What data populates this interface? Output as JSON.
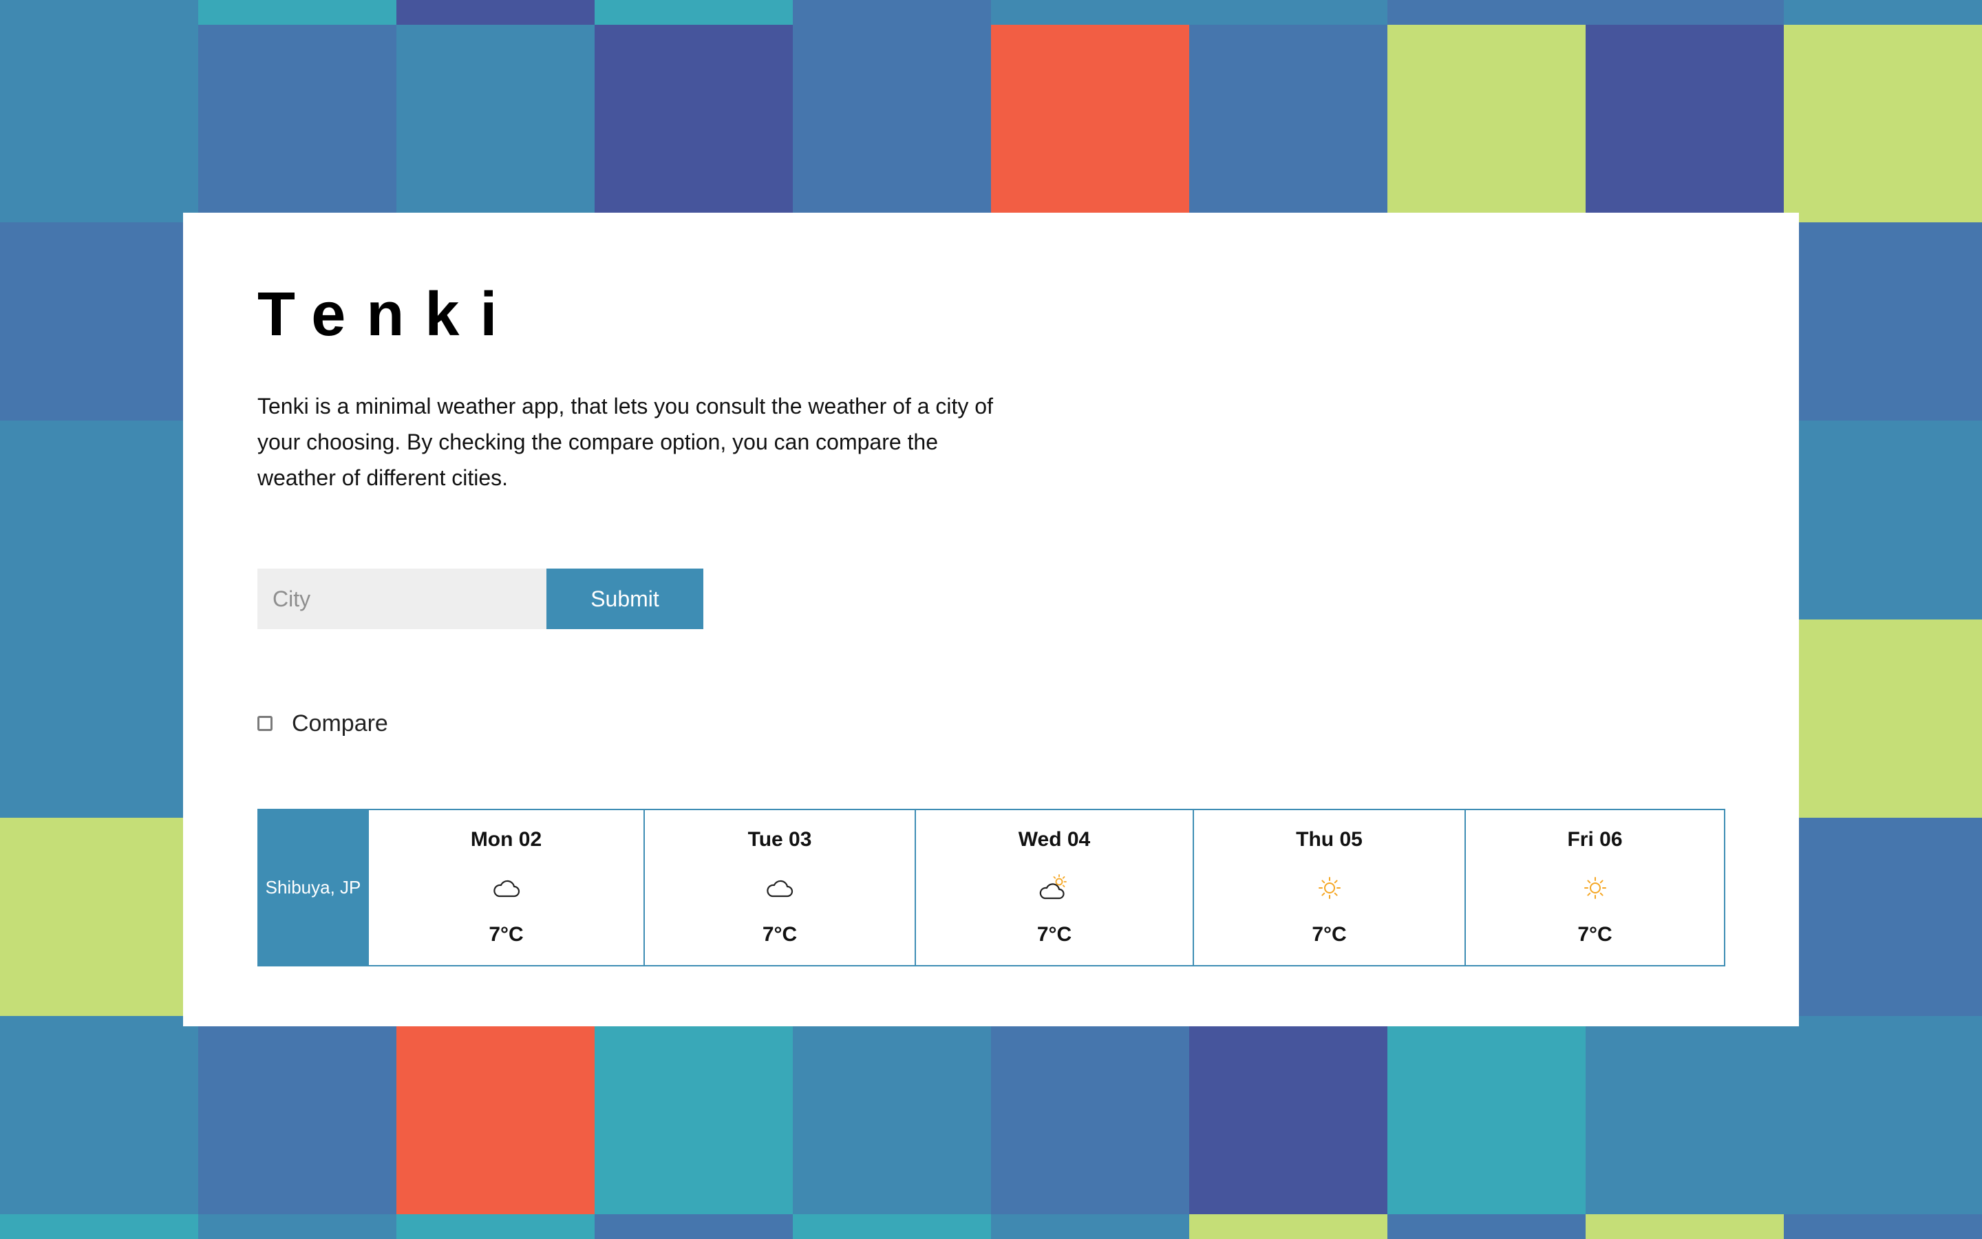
{
  "app": {
    "title": "Tenki",
    "description": "Tenki is a minimal weather app, that lets you consult the weather of a city of your choosing. By checking the compare option, you can compare the weather of different cities."
  },
  "search": {
    "placeholder": "City",
    "value": "",
    "submit_label": "Submit"
  },
  "compare": {
    "label": "Compare",
    "checked": false
  },
  "forecast": {
    "location": "Shibuya, JP",
    "days": [
      {
        "label": "Mon 02",
        "icon": "cloud-icon",
        "temp": "7°C"
      },
      {
        "label": "Tue 03",
        "icon": "cloud-icon",
        "temp": "7°C"
      },
      {
        "label": "Wed 04",
        "icon": "partly-cloudy-icon",
        "temp": "7°C"
      },
      {
        "label": "Thu 05",
        "icon": "sun-icon",
        "temp": "7°C"
      },
      {
        "label": "Fri 06",
        "icon": "sun-icon",
        "temp": "7°C"
      }
    ]
  },
  "colors": {
    "accent": "#3e8db4",
    "tile_blue": "#4089b1",
    "tile_steel": "#4676ad",
    "tile_teal": "#39a8b8",
    "tile_indigo": "#46559c",
    "tile_coral": "#f25e44",
    "tile_lime": "#c5de77",
    "sun": "#f5a623"
  }
}
